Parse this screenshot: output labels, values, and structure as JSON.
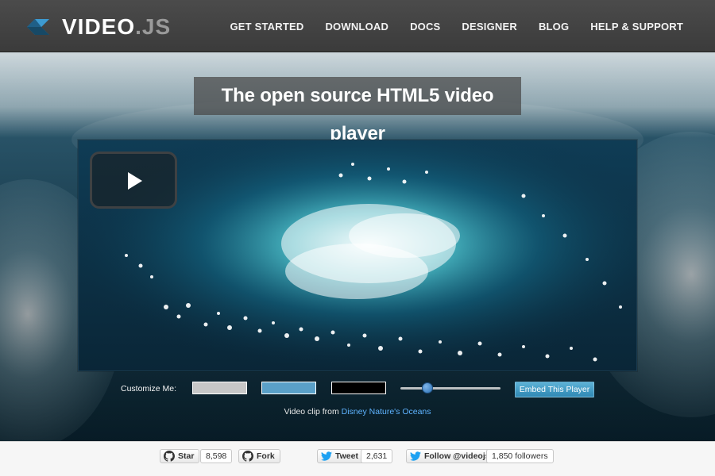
{
  "header": {
    "brand": {
      "name": "VIDEO",
      "suffix": ".JS",
      "logo_icon": "videojs-logo-icon"
    },
    "nav": [
      {
        "label": "GET STARTED"
      },
      {
        "label": "DOWNLOAD"
      },
      {
        "label": "DOCS"
      },
      {
        "label": "DESIGNER"
      },
      {
        "label": "BLOG"
      },
      {
        "label": "HELP & SUPPORT"
      }
    ]
  },
  "hero": {
    "headline": "The open source HTML5 video player",
    "player": {
      "big_play_icon": "play-icon"
    }
  },
  "customize": {
    "label": "Customize Me:",
    "swatches": [
      {
        "name": "swatch-light",
        "color": "#c7c7c7"
      },
      {
        "name": "swatch-blue",
        "color": "#5aa0c8"
      },
      {
        "name": "swatch-dark",
        "color": "#000000"
      }
    ],
    "slider": {
      "value": 0.27
    },
    "embed_button": "Embed This Player"
  },
  "credit": {
    "prefix": "Video clip from ",
    "link_text": "Disney Nature's Oceans"
  },
  "social": {
    "github_star": {
      "label": "Star",
      "count": "8,598",
      "icon": "github-icon"
    },
    "github_fork": {
      "label": "Fork",
      "icon": "github-icon"
    },
    "tweet": {
      "label": "Tweet",
      "count": "2,631",
      "icon": "twitter-icon"
    },
    "follow": {
      "label": "Follow @videojs",
      "count": "1,850 followers",
      "icon": "twitter-icon"
    }
  },
  "colors": {
    "header_bg": "#444444",
    "accent": "#2f88b4",
    "link": "#5fb3ff",
    "footer_bg": "#f6f6f6"
  }
}
